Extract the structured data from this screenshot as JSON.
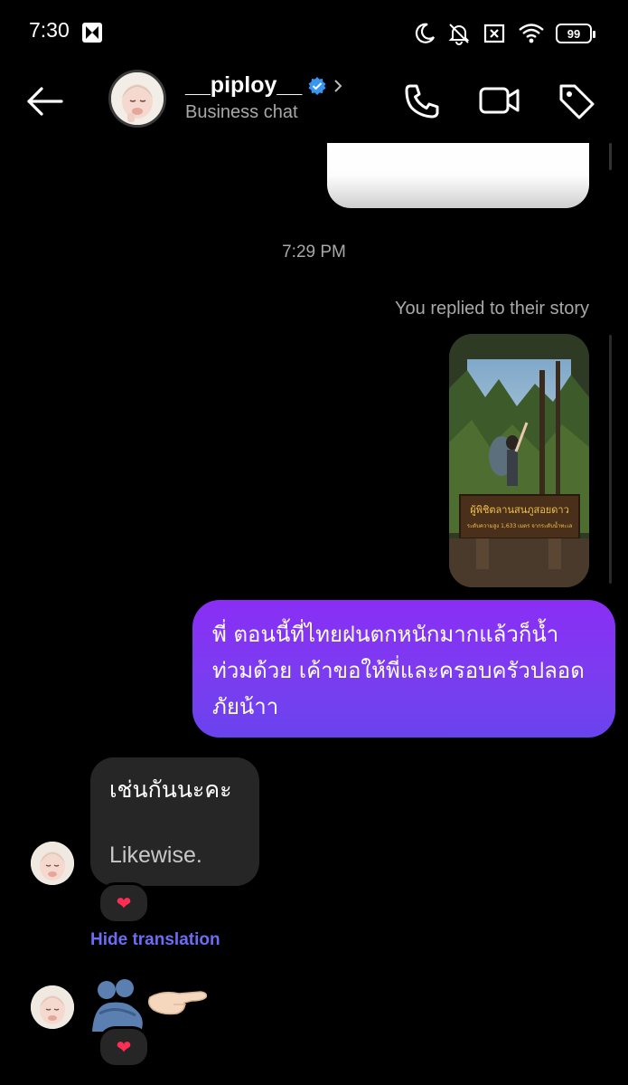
{
  "status_bar": {
    "time": "7:30",
    "battery": "99"
  },
  "header": {
    "username": "__piploy__",
    "subtitle": "Business chat"
  },
  "chat": {
    "timestamp": "7:29 PM",
    "story_reply_label": "You replied to their story",
    "sent_message": "พี่ ตอนนี้ที่ไทยฝนตกหนักมากแล้วก็น้ำท่วมด้วย เค้าขอให้พี่และครอบครัวปลอดภัยน้าา",
    "received_original": "เช่นกันนะคะ",
    "received_translation": "Likewise.",
    "reaction_emoji": "❤",
    "hide_translation_label": "Hide translation",
    "story_sign_text": "ผู้พิชิตลานสนภูสอยดาว",
    "story_sign_subtext": "ระดับความสูง 1,633 เมตร จากระดับน้ำทะเล"
  },
  "colors": {
    "background": "#000000",
    "sent_bubble": "#7b3cf0",
    "received_bubble": "#262626",
    "link": "#6c6cf5",
    "verified": "#3797f0"
  }
}
